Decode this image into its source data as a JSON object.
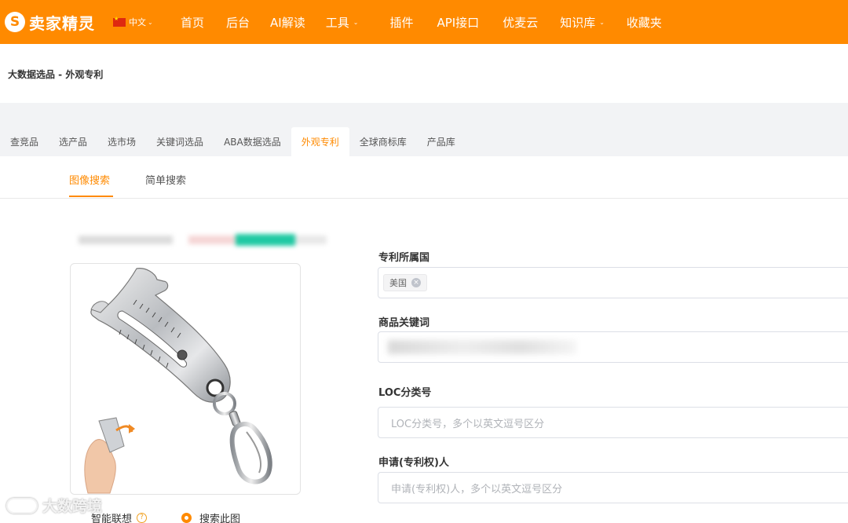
{
  "brand": {
    "logo_letter": "S",
    "name": "卖家精灵"
  },
  "language": {
    "label": "中文"
  },
  "nav": {
    "items": [
      {
        "label": "首页",
        "dropdown": false
      },
      {
        "label": "后台",
        "dropdown": false
      },
      {
        "label": "AI解读",
        "dropdown": false
      },
      {
        "label": "工具",
        "dropdown": true
      },
      {
        "label": "插件",
        "dropdown": false
      },
      {
        "label": "API接口",
        "dropdown": false
      },
      {
        "label": "优麦云",
        "dropdown": false
      },
      {
        "label": "知识库",
        "dropdown": true
      },
      {
        "label": "收藏夹",
        "dropdown": false
      }
    ]
  },
  "breadcrumb": "大数据选品 - 外观专利",
  "tabs": [
    {
      "label": "查竞品",
      "active": false
    },
    {
      "label": "选产品",
      "active": false
    },
    {
      "label": "选市场",
      "active": false
    },
    {
      "label": "关键词选品",
      "active": false
    },
    {
      "label": "ABA数据选品",
      "active": false
    },
    {
      "label": "外观专利",
      "active": true
    },
    {
      "label": "全球商标库",
      "active": false
    },
    {
      "label": "产品库",
      "active": false
    }
  ],
  "subtabs": {
    "image_search": "图像搜索",
    "simple_search": "简单搜索"
  },
  "image_options": {
    "smart_assoc": "智能联想",
    "search_this": "搜索此图"
  },
  "watermark": "大数跨境",
  "form": {
    "country_label": "专利所属国",
    "country_tag": "美国",
    "keyword_label": "商品关键词",
    "loc_label": "LOC分类号",
    "loc_placeholder": "LOC分类号，多个以英文逗号区分",
    "applicant_label": "申请(专利权)人",
    "applicant_placeholder": "申请(专利权)人，多个以英文逗号区分"
  },
  "colors": {
    "brand_orange": "#ff8a00",
    "tab_band": "#f2f3f5"
  },
  "icons": [
    "logo-icon",
    "china-flag-icon",
    "chevron-down-icon",
    "help-icon",
    "tag-close-icon",
    "radio-selected-icon"
  ]
}
